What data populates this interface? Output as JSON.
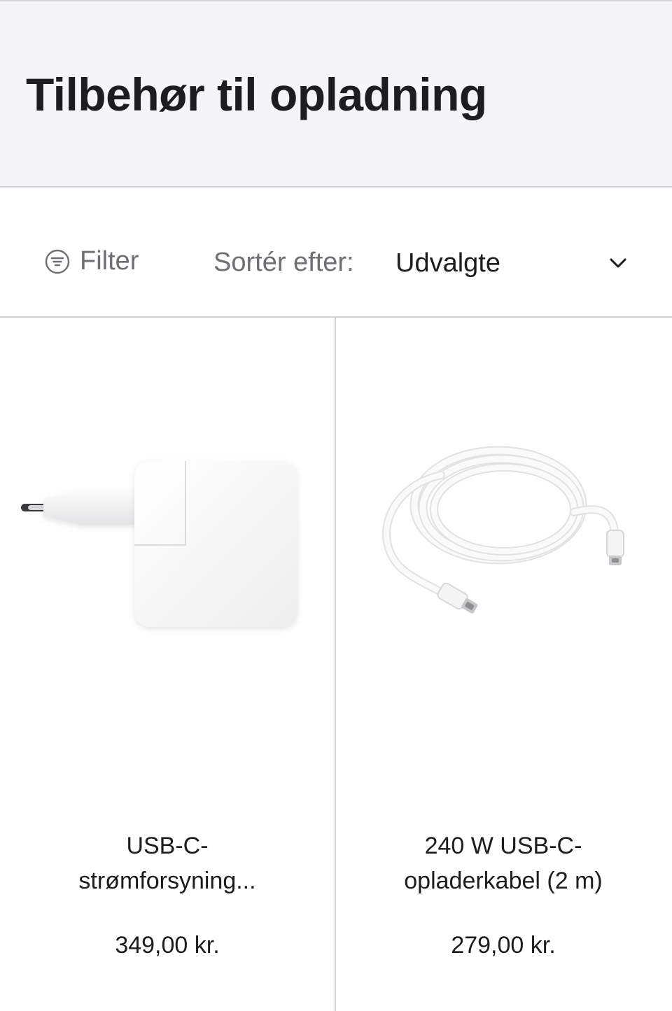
{
  "header": {
    "title": "Tilbehør til opladning"
  },
  "toolbar": {
    "filter_label": "Filter",
    "filter_icon": "filter-icon",
    "sort_label": "Sortér efter:",
    "sort_value": "Udvalgte",
    "sort_icon": "chevron-down-icon"
  },
  "products": [
    {
      "name_line1": "USB-C-",
      "name_line2": "strømforsyning...",
      "price": "349,00 kr.",
      "image": "power-adapter-image"
    },
    {
      "name_line1": "240 W USB-C-",
      "name_line2": "opladerkabel (2 m)",
      "price": "279,00 kr.",
      "image": "usb-c-cable-image"
    }
  ],
  "colors": {
    "text": "#1d1d1f",
    "secondary_text": "#6e6e73",
    "header_bg": "#f5f5f7",
    "divider": "#d2d2d7"
  }
}
